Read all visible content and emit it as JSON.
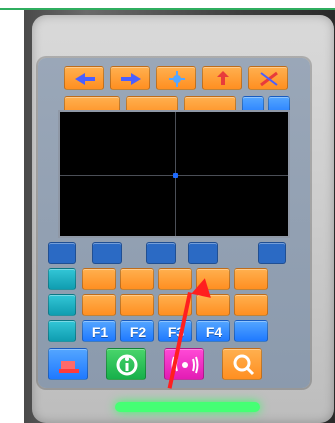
{
  "screen": {
    "function_keys": [
      "F1",
      "F2",
      "F3",
      "F4"
    ]
  },
  "annotation": {
    "arrow_color": "#ff1f1f"
  },
  "device": {
    "frame_color": "#cfcfcf",
    "indicator_color": "#45ff74"
  },
  "icons": {
    "top_row": [
      "left-arrow-icon",
      "right-arrow-icon",
      "blue-star-icon",
      "needle-up-icon",
      "thread-cut-icon"
    ],
    "bottom_bar": [
      "sewing-machine-icon",
      "info-icon",
      "signal-icon",
      "search-icon"
    ]
  }
}
